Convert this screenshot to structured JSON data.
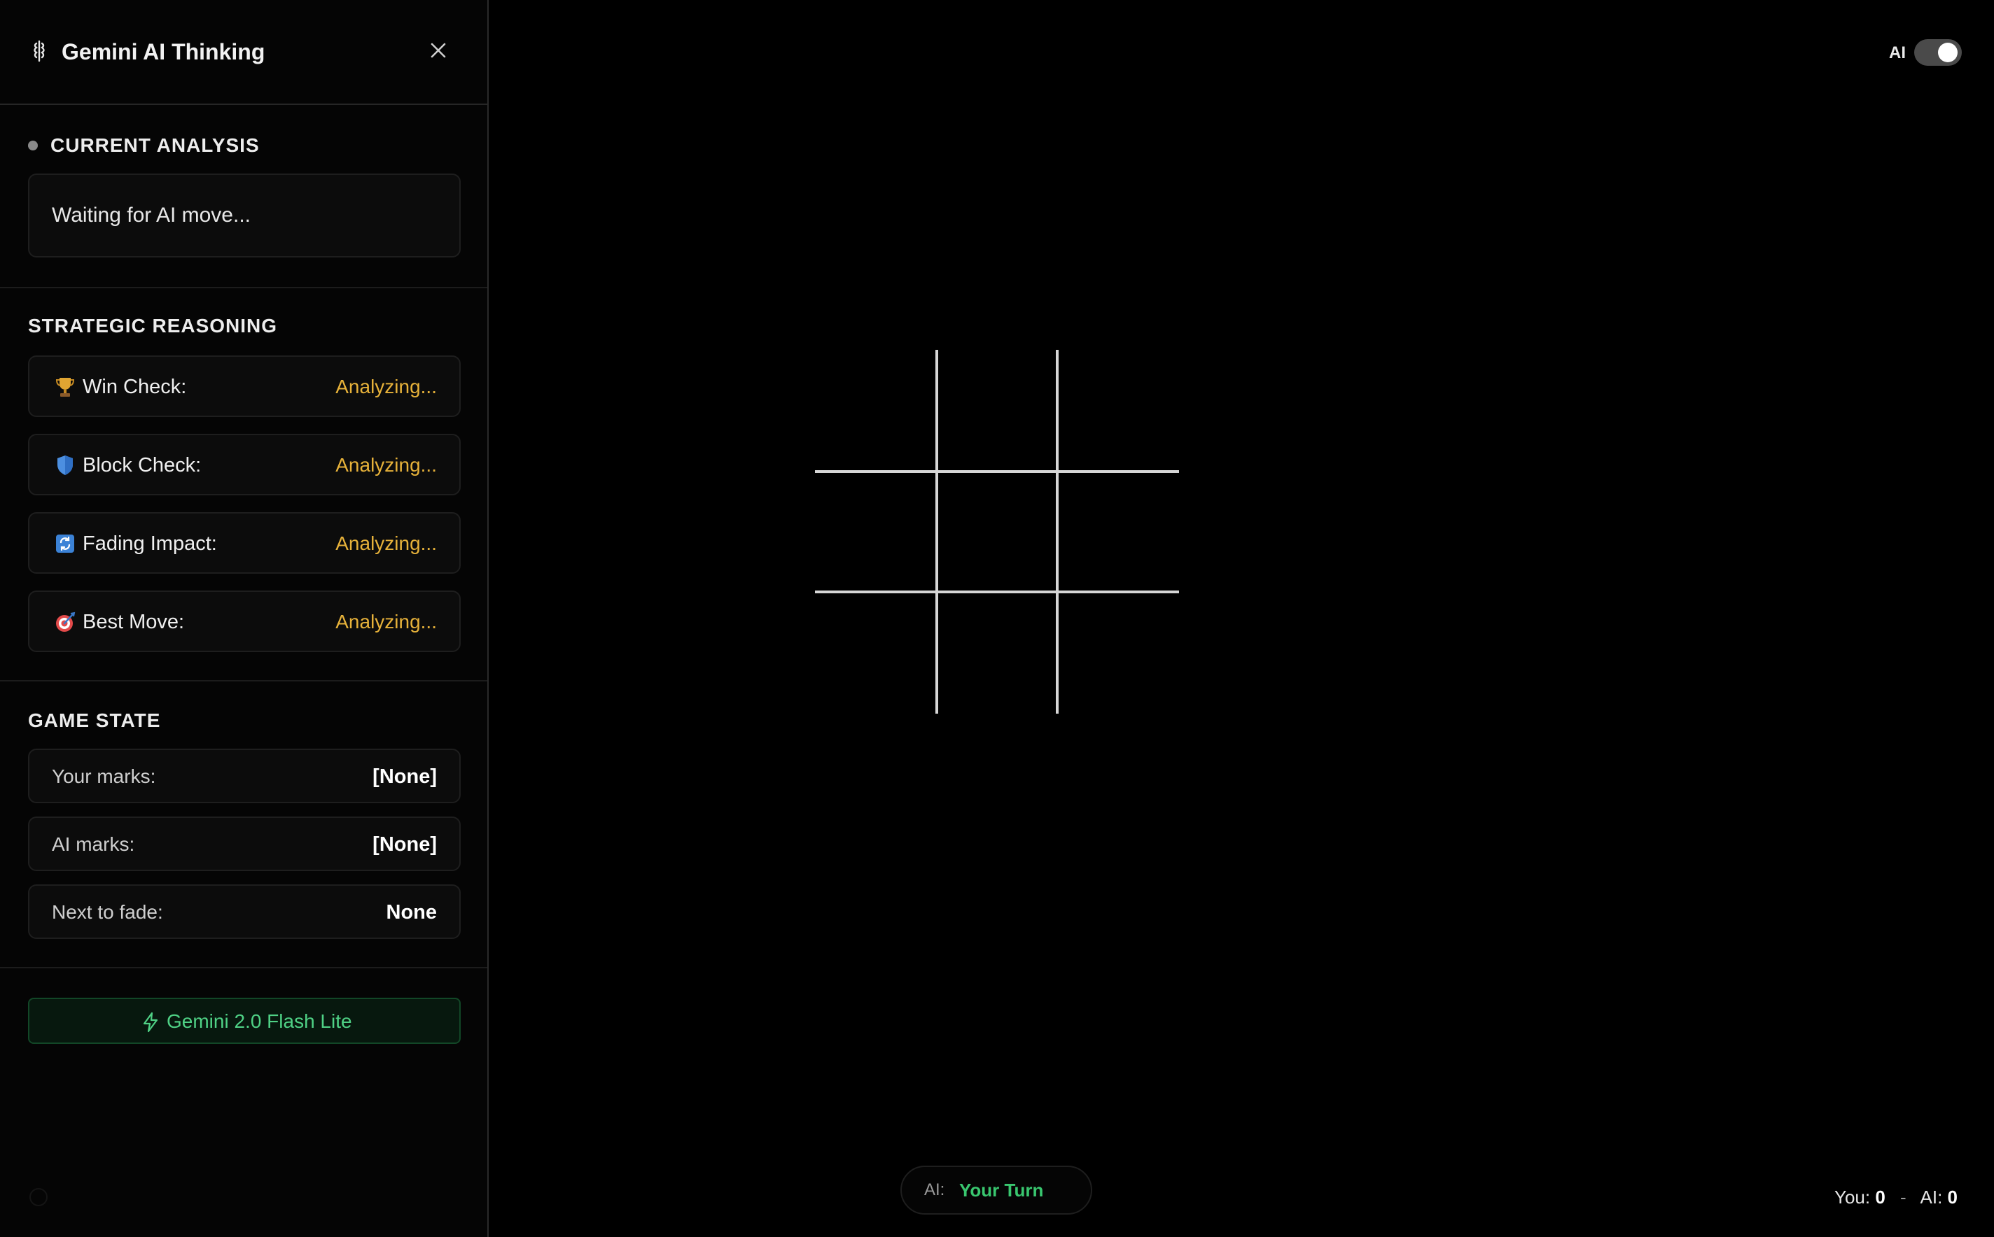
{
  "sidebar": {
    "title": "Gemini AI Thinking",
    "current_analysis": {
      "heading": "CURRENT ANALYSIS",
      "text": "Waiting for AI move..."
    },
    "strategic_reasoning": {
      "heading": "STRATEGIC REASONING",
      "items": [
        {
          "icon": "trophy-icon",
          "label": "Win Check:",
          "value": "Analyzing..."
        },
        {
          "icon": "shield-icon",
          "label": "Block Check:",
          "value": "Analyzing..."
        },
        {
          "icon": "refresh-icon",
          "label": "Fading Impact:",
          "value": "Analyzing..."
        },
        {
          "icon": "target-icon",
          "label": "Best Move:",
          "value": "Analyzing..."
        }
      ]
    },
    "game_state": {
      "heading": "GAME STATE",
      "rows": [
        {
          "label": "Your marks:",
          "value": "[None]"
        },
        {
          "label": "AI marks:",
          "value": "[None]"
        },
        {
          "label": "Next to fade:",
          "value": "None"
        }
      ]
    },
    "model_label": "Gemini 2.0 Flash Lite"
  },
  "header": {
    "ai_toggle_label": "AI",
    "ai_toggle_on": true
  },
  "board": {
    "cells": [
      "",
      "",
      "",
      "",
      "",
      "",
      "",
      "",
      ""
    ]
  },
  "status": {
    "prefix": "AI:",
    "turn": "Your Turn"
  },
  "score": {
    "you_label": "You:",
    "you": "0",
    "separator": "-",
    "ai_label": "AI:",
    "ai": "0"
  },
  "colors": {
    "accent_green": "#39c76f",
    "analyzing_amber": "#e7b23a",
    "background": "#000000"
  }
}
